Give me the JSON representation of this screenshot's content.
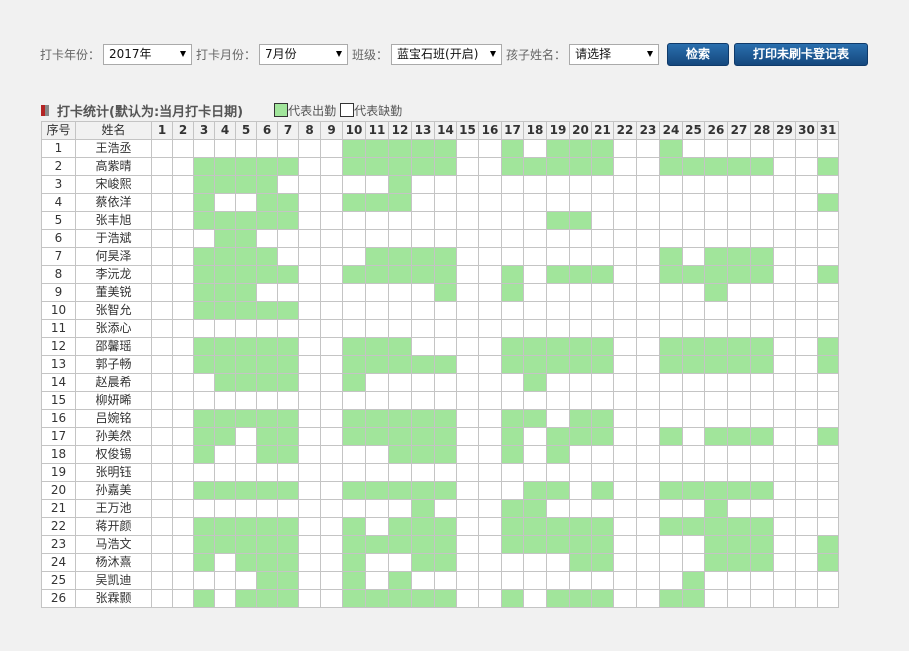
{
  "filters": {
    "year_label": "打卡年份：",
    "year_value": "2017年",
    "month_label": "打卡月份：",
    "month_value": "7月份",
    "class_label": "班级：",
    "class_value": "蓝宝石班(开启)",
    "child_label": "孩子姓名：",
    "child_value": "请选择",
    "search_button": "检索",
    "print_button": "打印未刷卡登记表"
  },
  "section": {
    "title": "打卡统计(默认为:当月打卡日期)",
    "legend_present": "代表出勤",
    "legend_absent": "代表缺勤"
  },
  "colors": {
    "present": "#a1e59b",
    "absent": "#ffffff",
    "button": "#1d5a96",
    "title_mark": "#b32424"
  },
  "table": {
    "col_index": "序号",
    "col_name": "姓名",
    "days": [
      "1",
      "2",
      "3",
      "4",
      "5",
      "6",
      "7",
      "8",
      "9",
      "10",
      "11",
      "12",
      "13",
      "14",
      "15",
      "16",
      "17",
      "18",
      "19",
      "20",
      "21",
      "22",
      "23",
      "24",
      "25",
      "26",
      "27",
      "28",
      "29",
      "30",
      "31"
    ],
    "rows": [
      {
        "index": "1",
        "name": "王浩丞",
        "present": [
          10,
          11,
          12,
          13,
          14,
          17,
          19,
          20,
          21,
          24
        ]
      },
      {
        "index": "2",
        "name": "高紫晴",
        "present": [
          3,
          4,
          5,
          6,
          7,
          10,
          11,
          12,
          13,
          14,
          17,
          18,
          19,
          20,
          21,
          24,
          25,
          26,
          27,
          28,
          31
        ]
      },
      {
        "index": "3",
        "name": "宋峻熙",
        "present": [
          3,
          4,
          5,
          6,
          12
        ]
      },
      {
        "index": "4",
        "name": "蔡依洋",
        "present": [
          3,
          6,
          7,
          10,
          11,
          12,
          31
        ]
      },
      {
        "index": "5",
        "name": "张丰旭",
        "present": [
          3,
          4,
          5,
          6,
          7,
          19,
          20
        ]
      },
      {
        "index": "6",
        "name": "于浩斌",
        "present": [
          4,
          5
        ]
      },
      {
        "index": "7",
        "name": "何昊泽",
        "present": [
          3,
          4,
          5,
          6,
          11,
          12,
          13,
          14,
          24,
          26,
          27,
          28
        ]
      },
      {
        "index": "8",
        "name": "李沅龙",
        "present": [
          3,
          4,
          5,
          6,
          7,
          10,
          11,
          12,
          13,
          14,
          17,
          19,
          20,
          21,
          24,
          25,
          26,
          27,
          28,
          31
        ]
      },
      {
        "index": "9",
        "name": "董美锐",
        "present": [
          3,
          4,
          5,
          14,
          17,
          26
        ]
      },
      {
        "index": "10",
        "name": "张智允",
        "present": [
          3,
          4,
          5,
          6,
          7
        ]
      },
      {
        "index": "11",
        "name": "张添心",
        "present": []
      },
      {
        "index": "12",
        "name": "邵馨瑶",
        "present": [
          3,
          4,
          5,
          6,
          7,
          10,
          11,
          12,
          17,
          18,
          19,
          20,
          21,
          24,
          25,
          26,
          27,
          28,
          31
        ]
      },
      {
        "index": "13",
        "name": "郭子畅",
        "present": [
          3,
          4,
          5,
          6,
          7,
          10,
          11,
          12,
          13,
          14,
          17,
          18,
          19,
          20,
          21,
          24,
          25,
          26,
          27,
          28,
          31
        ]
      },
      {
        "index": "14",
        "name": "赵晨希",
        "present": [
          4,
          5,
          6,
          7,
          10,
          18
        ]
      },
      {
        "index": "15",
        "name": "柳妍晞",
        "present": []
      },
      {
        "index": "16",
        "name": "吕婉铭",
        "present": [
          3,
          4,
          5,
          6,
          7,
          10,
          11,
          12,
          13,
          14,
          17,
          18,
          20,
          21
        ]
      },
      {
        "index": "17",
        "name": "孙美然",
        "present": [
          3,
          4,
          6,
          7,
          10,
          11,
          12,
          13,
          14,
          17,
          19,
          20,
          21,
          24,
          26,
          27,
          28,
          31
        ]
      },
      {
        "index": "18",
        "name": "权俊锡",
        "present": [
          3,
          6,
          7,
          12,
          13,
          14,
          17,
          19
        ]
      },
      {
        "index": "19",
        "name": "张明钰",
        "present": []
      },
      {
        "index": "20",
        "name": "孙嘉美",
        "present": [
          3,
          4,
          5,
          6,
          7,
          10,
          11,
          12,
          13,
          14,
          18,
          19,
          21,
          24,
          25,
          26,
          27,
          28
        ]
      },
      {
        "index": "21",
        "name": "王万池",
        "present": [
          13,
          17,
          18,
          26
        ]
      },
      {
        "index": "22",
        "name": "蒋开颜",
        "present": [
          3,
          4,
          5,
          6,
          7,
          10,
          12,
          13,
          14,
          17,
          18,
          19,
          20,
          21,
          24,
          25,
          26,
          27,
          28
        ]
      },
      {
        "index": "23",
        "name": "马浩文",
        "present": [
          3,
          4,
          5,
          6,
          7,
          10,
          11,
          12,
          13,
          14,
          17,
          18,
          19,
          20,
          21,
          26,
          27,
          28,
          31
        ]
      },
      {
        "index": "24",
        "name": "杨沐熹",
        "present": [
          3,
          5,
          6,
          7,
          10,
          13,
          14,
          20,
          21,
          26,
          27,
          28,
          31
        ]
      },
      {
        "index": "25",
        "name": "吴凯迪",
        "present": [
          6,
          7,
          10,
          12,
          25
        ]
      },
      {
        "index": "26",
        "name": "张霖颢",
        "present": [
          3,
          5,
          6,
          7,
          10,
          11,
          12,
          13,
          14,
          17,
          19,
          20,
          21,
          24,
          25
        ]
      }
    ]
  }
}
